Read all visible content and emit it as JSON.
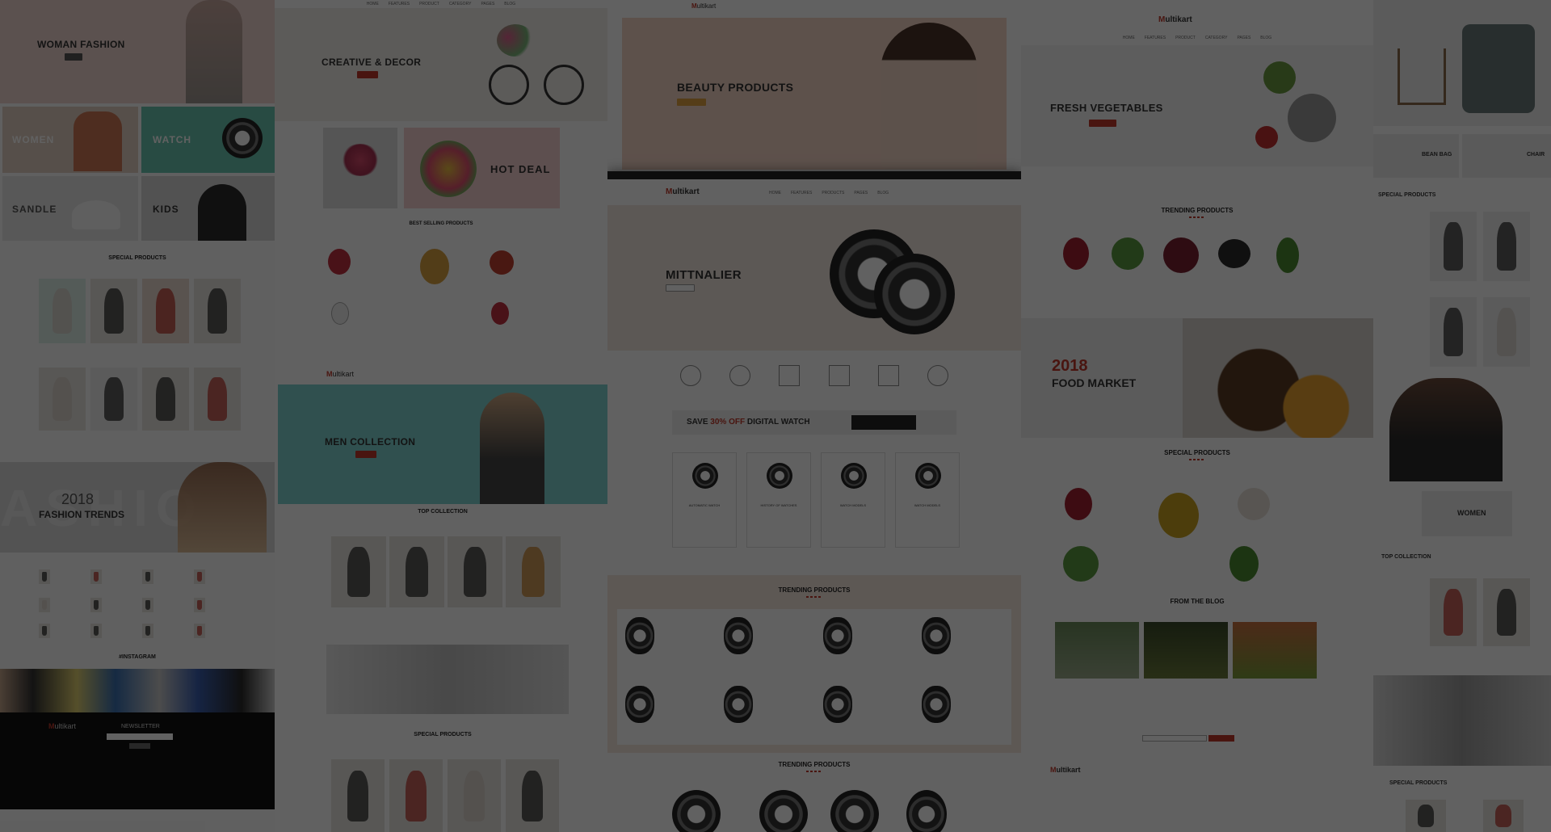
{
  "brand": {
    "logo_prefix": "M",
    "logo_suffix": "ultikart"
  },
  "col1": {
    "hero": "WOMAN FASHION",
    "tiles": [
      "WOMEN",
      "WATCH",
      "SANDLE",
      "KIDS"
    ],
    "special": "SPECIAL PRODUCTS",
    "trends_year": "2018",
    "trends_title": "FASHION TRENDS",
    "trends_bg": "ASHIO",
    "instagram": "#INSTAGRAM",
    "newsletter": "NEWSLETTER"
  },
  "col2": {
    "hero": "CREATIVE & DECOR",
    "hot_deal": "HOT DEAL",
    "best_selling": "BEST SELLING PRODUCTS",
    "men_hero": "MEN COLLECTION",
    "top_collection": "TOP COLLECTION",
    "special": "SPECIAL PRODUCTS"
  },
  "col3": {
    "hero": "BEAUTY PRODUCTS",
    "watch_hero": "MITTNALIER",
    "save_prefix": "SAVE ",
    "save_pct": "30% OFF",
    "save_suffix": " DIGITAL WATCH",
    "categories": [
      "AUTOMATIC WATCH",
      "HISTORY OF WATCHES",
      "WATCH MODELS",
      "WATCH MODELS"
    ],
    "trending": "TRENDING PRODUCTS",
    "trending2": "TRENDING PRODUCTS"
  },
  "col4": {
    "hero": "FRESH VEGETABLES",
    "trending": "TRENDING PRODUCTS",
    "year": "2018",
    "food_market": "FOOD MARKET",
    "special": "SPECIAL PRODUCTS",
    "blog": "FROM THE BLOG"
  },
  "col5": {
    "bean_bag": "BEAN BAG",
    "chair": "CHAIR",
    "special": "SPECIAL PRODUCTS",
    "women": "WOMEN",
    "top_collection": "TOP COLLECTION",
    "special2": "SPECIAL PRODUCTS"
  },
  "colors": {
    "accent": "#c0392b",
    "overlay": "rgba(0,0,0,0.62)"
  }
}
